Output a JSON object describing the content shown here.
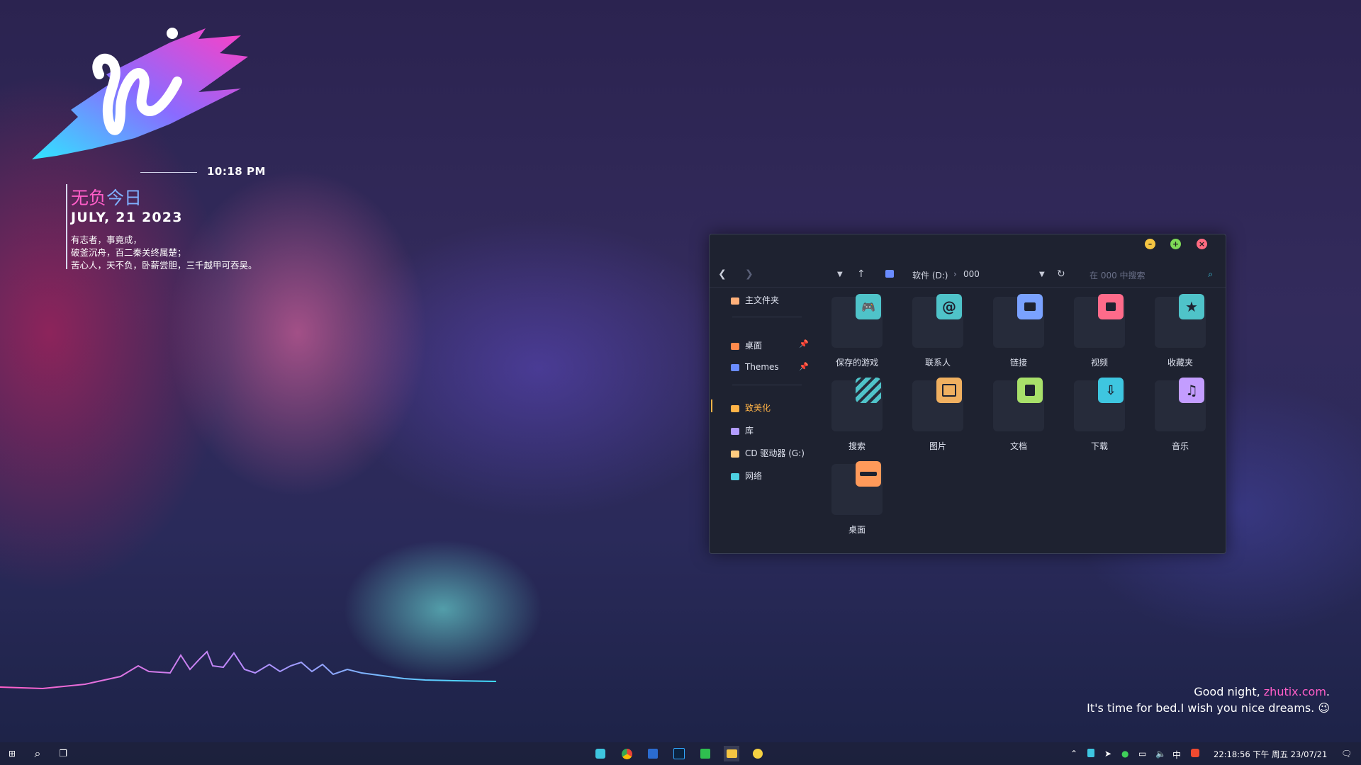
{
  "widget": {
    "time": "10:18 PM",
    "title_part1": "无负",
    "title_part2": "今日",
    "date": "JULY, 21 2023",
    "poem": [
      "有志者，事竟成，",
      "破釜沉舟，百二秦关终属楚；",
      "苦心人，天不负，卧薪尝胆，三千越甲可吞吴。"
    ],
    "colors": {
      "pink": "#ff5ec8",
      "blue": "#7fb0ff",
      "cyan": "#3ee0ff"
    }
  },
  "greeting": {
    "line1_pre": "Good night, ",
    "site": "zhutix.com",
    "line1_post": ".",
    "line2": "It's time for bed.I wish you nice dreams. 😉"
  },
  "explorer": {
    "path_drive": "软件 (D:)",
    "path_folder": "000",
    "search_placeholder": "在 000 中搜索",
    "sidebar": [
      {
        "label": "主文件夹",
        "icon": "home-icon",
        "color": "#ffffff"
      },
      {
        "label": "桌面",
        "icon": "desktop-icon",
        "color": "#ff8a4c",
        "pinned": true
      },
      {
        "label": "Themes",
        "icon": "folder-icon",
        "color": "#6a8cff",
        "pinned": true
      },
      {
        "label": "致美化",
        "icon": "folder-icon",
        "color": "#ffb347"
      },
      {
        "label": "库",
        "icon": "library-icon",
        "color": "#b39dff"
      },
      {
        "label": "CD 驱动器 (G:)",
        "icon": "disc-icon",
        "color": "#ffcc80"
      },
      {
        "label": "网络",
        "icon": "network-icon",
        "color": "#4dd0e1"
      }
    ],
    "folders": [
      {
        "label": "保存的游戏",
        "icon": "gamepad-icon",
        "color": "#4fc3c9"
      },
      {
        "label": "联系人",
        "icon": "at-icon",
        "color": "#4fc3c9"
      },
      {
        "label": "链接",
        "icon": "folder-icon",
        "color": "#7aa2ff"
      },
      {
        "label": "视频",
        "icon": "video-icon",
        "color": "#ff6b8a"
      },
      {
        "label": "收藏夹",
        "icon": "star-icon",
        "color": "#4fc3c9"
      },
      {
        "label": "搜索",
        "icon": "search-stripes-icon",
        "color": "#4fc3c9"
      },
      {
        "label": "图片",
        "icon": "image-icon",
        "color": "#f0b060"
      },
      {
        "label": "文档",
        "icon": "document-icon",
        "color": "#a8e06a"
      },
      {
        "label": "下载",
        "icon": "cloud-download-icon",
        "color": "#3ec6e0"
      },
      {
        "label": "音乐",
        "icon": "music-icon",
        "color": "#c39dff"
      },
      {
        "label": "桌面",
        "icon": "desktop-drive-icon",
        "color": "#ff9a5a"
      }
    ]
  },
  "taskbar": {
    "apps": [
      "bilibili-icon",
      "chrome-icon",
      "word-icon",
      "photoshop-icon",
      "hbuilder-icon",
      "file-explorer-icon",
      "misc-app-icon"
    ],
    "ime": "中",
    "clock": "22:18:56 下午 周五 23/07/21"
  }
}
